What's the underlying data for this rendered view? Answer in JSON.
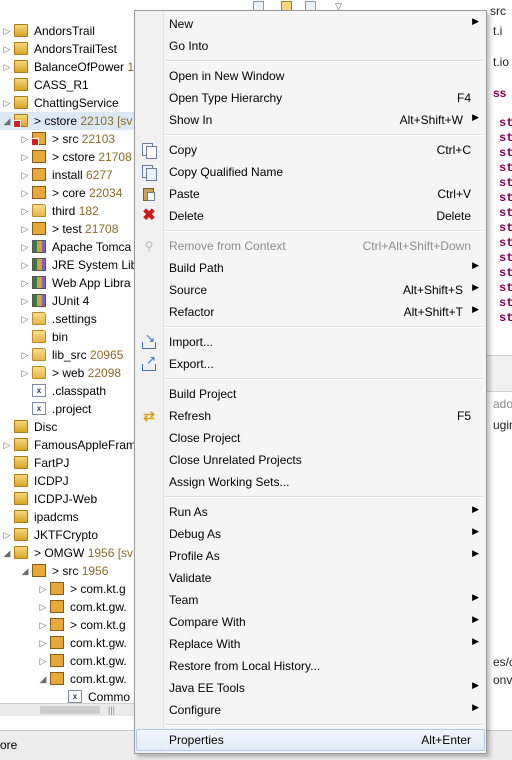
{
  "explorer": {
    "items": [
      {
        "label": "AndorsTrail",
        "count": "",
        "indent": 0,
        "arrow": "▷",
        "icon": "project-icon",
        "kind": "project"
      },
      {
        "label": "AndorsTrailTest",
        "count": "",
        "indent": 0,
        "arrow": "▷",
        "icon": "project-icon",
        "kind": "project"
      },
      {
        "label": "BalanceOfPower",
        "count": "1",
        "indent": 0,
        "arrow": "▷",
        "icon": "project-icon",
        "kind": "project"
      },
      {
        "label": "CASS_R1",
        "count": "",
        "indent": 0,
        "arrow": "",
        "icon": "project-icon",
        "kind": "project"
      },
      {
        "label": "ChattingService",
        "count": "",
        "indent": 0,
        "arrow": "▷",
        "icon": "project-icon",
        "kind": "project"
      },
      {
        "label": "> cstore",
        "count": "22103 [sv",
        "indent": 0,
        "arrow": "◢",
        "icon": "project-icon",
        "kind": "project",
        "error": true,
        "selected": true
      },
      {
        "label": "> src",
        "count": "22103",
        "indent": 1,
        "arrow": "▷",
        "icon": "source-folder-icon",
        "kind": "package",
        "error": true
      },
      {
        "label": "> cstore",
        "count": "21708",
        "indent": 1,
        "arrow": "▷",
        "icon": "source-folder-icon",
        "kind": "package"
      },
      {
        "label": "install",
        "count": "6277",
        "indent": 1,
        "arrow": "▷",
        "icon": "source-folder-icon",
        "kind": "package"
      },
      {
        "label": "> core",
        "count": "22034",
        "indent": 1,
        "arrow": "▷",
        "icon": "source-folder-icon",
        "kind": "package"
      },
      {
        "label": "third",
        "count": "182",
        "indent": 1,
        "arrow": "▷",
        "icon": "folder-icon",
        "kind": "folder"
      },
      {
        "label": "> test",
        "count": "21708",
        "indent": 1,
        "arrow": "▷",
        "icon": "source-folder-icon",
        "kind": "package"
      },
      {
        "label": "Apache Tomca",
        "count": "",
        "indent": 1,
        "arrow": "▷",
        "icon": "library-icon",
        "kind": "lib"
      },
      {
        "label": "JRE System Lib",
        "count": "",
        "indent": 1,
        "arrow": "▷",
        "icon": "library-icon",
        "kind": "lib"
      },
      {
        "label": "Web App Libra",
        "count": "",
        "indent": 1,
        "arrow": "▷",
        "icon": "library-icon",
        "kind": "lib"
      },
      {
        "label": "JUnit 4",
        "count": "",
        "indent": 1,
        "arrow": "▷",
        "icon": "library-icon",
        "kind": "lib"
      },
      {
        "label": ".settings",
        "count": "",
        "indent": 1,
        "arrow": "▷",
        "icon": "folder-icon",
        "kind": "folder"
      },
      {
        "label": "bin",
        "count": "",
        "indent": 1,
        "arrow": "",
        "icon": "folder-icon",
        "kind": "folder"
      },
      {
        "label": "lib_src",
        "count": "20965",
        "indent": 1,
        "arrow": "▷",
        "icon": "folder-icon",
        "kind": "folder"
      },
      {
        "label": "> web",
        "count": "22098",
        "indent": 1,
        "arrow": "▷",
        "icon": "folder-icon",
        "kind": "folder"
      },
      {
        "label": ".classpath",
        "count": "",
        "indent": 1,
        "arrow": "",
        "icon": "file-icon",
        "kind": "file"
      },
      {
        "label": ".project",
        "count": "",
        "indent": 1,
        "arrow": "",
        "icon": "file-icon",
        "kind": "file"
      },
      {
        "label": "Disc",
        "count": "",
        "indent": 0,
        "arrow": "",
        "icon": "project-icon",
        "kind": "project"
      },
      {
        "label": "FamousAppleFram",
        "count": "",
        "indent": 0,
        "arrow": "▷",
        "icon": "project-icon",
        "kind": "project"
      },
      {
        "label": "FartPJ",
        "count": "",
        "indent": 0,
        "arrow": "",
        "icon": "project-icon",
        "kind": "project"
      },
      {
        "label": "ICDPJ",
        "count": "",
        "indent": 0,
        "arrow": "",
        "icon": "project-icon",
        "kind": "project"
      },
      {
        "label": "ICDPJ-Web",
        "count": "",
        "indent": 0,
        "arrow": "",
        "icon": "project-icon",
        "kind": "project"
      },
      {
        "label": "ipadcms",
        "count": "",
        "indent": 0,
        "arrow": "",
        "icon": "project-icon",
        "kind": "project"
      },
      {
        "label": "JKTFCrypto",
        "count": "",
        "indent": 0,
        "arrow": "▷",
        "icon": "project-icon",
        "kind": "project"
      },
      {
        "label": "> OMGW",
        "count": "1956 [sv",
        "indent": 0,
        "arrow": "◢",
        "icon": "project-icon",
        "kind": "project"
      },
      {
        "label": "> src",
        "count": "1956",
        "indent": 1,
        "arrow": "◢",
        "icon": "source-folder-icon",
        "kind": "package"
      },
      {
        "label": "> com.kt.g",
        "count": "",
        "indent": 2,
        "arrow": "▷",
        "icon": "package-icon",
        "kind": "package"
      },
      {
        "label": "com.kt.gw.",
        "count": "",
        "indent": 2,
        "arrow": "▷",
        "icon": "package-icon",
        "kind": "package"
      },
      {
        "label": "> com.kt.g",
        "count": "",
        "indent": 2,
        "arrow": "▷",
        "icon": "package-icon",
        "kind": "package"
      },
      {
        "label": "com.kt.gw.",
        "count": "",
        "indent": 2,
        "arrow": "▷",
        "icon": "package-icon",
        "kind": "package"
      },
      {
        "label": "com.kt.gw.",
        "count": "",
        "indent": 2,
        "arrow": "▷",
        "icon": "package-icon",
        "kind": "package"
      },
      {
        "label": "com.kt.gw.",
        "count": "",
        "indent": 2,
        "arrow": "◢",
        "icon": "package-icon",
        "kind": "package"
      },
      {
        "label": "Commo",
        "count": "",
        "indent": 3,
        "arrow": "",
        "icon": "file-icon",
        "kind": "file"
      }
    ]
  },
  "context_menu": {
    "items": [
      {
        "type": "item",
        "label": "New",
        "shortcut": "",
        "submenu": true
      },
      {
        "type": "item",
        "label": "Go Into",
        "shortcut": ""
      },
      {
        "type": "sep"
      },
      {
        "type": "item",
        "label": "Open in New Window",
        "shortcut": ""
      },
      {
        "type": "item",
        "label": "Open Type Hierarchy",
        "shortcut": "F4"
      },
      {
        "type": "item",
        "label": "Show In",
        "shortcut": "Alt+Shift+W",
        "submenu": true
      },
      {
        "type": "sep"
      },
      {
        "type": "item",
        "label": "Copy",
        "shortcut": "Ctrl+C",
        "icon": "copy-icon",
        "iconClass": "copy"
      },
      {
        "type": "item",
        "label": "Copy Qualified Name",
        "shortcut": "",
        "icon": "copy-qualified-name-icon",
        "iconClass": "copyq"
      },
      {
        "type": "item",
        "label": "Paste",
        "shortcut": "Ctrl+V",
        "icon": "paste-icon",
        "iconClass": "paste"
      },
      {
        "type": "item",
        "label": "Delete",
        "shortcut": "Delete",
        "icon": "delete-icon",
        "iconClass": "delete",
        "glyph": "✖"
      },
      {
        "type": "sep"
      },
      {
        "type": "item",
        "label": "Remove from Context",
        "shortcut": "Ctrl+Alt+Shift+Down",
        "disabled": true,
        "icon": "remove-context-icon",
        "iconClass": "remove",
        "glyph": "⚲"
      },
      {
        "type": "item",
        "label": "Build Path",
        "shortcut": "",
        "submenu": true
      },
      {
        "type": "item",
        "label": "Source",
        "shortcut": "Alt+Shift+S",
        "submenu": true
      },
      {
        "type": "item",
        "label": "Refactor",
        "shortcut": "Alt+Shift+T",
        "submenu": true
      },
      {
        "type": "sep"
      },
      {
        "type": "item",
        "label": "Import...",
        "shortcut": "",
        "icon": "import-icon",
        "iconClass": "import"
      },
      {
        "type": "item",
        "label": "Export...",
        "shortcut": "",
        "icon": "export-icon",
        "iconClass": "export"
      },
      {
        "type": "sep"
      },
      {
        "type": "item",
        "label": "Build Project",
        "shortcut": ""
      },
      {
        "type": "item",
        "label": "Refresh",
        "shortcut": "F5",
        "icon": "refresh-icon",
        "iconClass": "refresh",
        "glyph": "⇄"
      },
      {
        "type": "item",
        "label": "Close Project",
        "shortcut": ""
      },
      {
        "type": "item",
        "label": "Close Unrelated Projects",
        "shortcut": ""
      },
      {
        "type": "item",
        "label": "Assign Working Sets...",
        "shortcut": ""
      },
      {
        "type": "sep"
      },
      {
        "type": "item",
        "label": "Run As",
        "shortcut": "",
        "submenu": true
      },
      {
        "type": "item",
        "label": "Debug As",
        "shortcut": "",
        "submenu": true
      },
      {
        "type": "item",
        "label": "Profile As",
        "shortcut": "",
        "submenu": true
      },
      {
        "type": "item",
        "label": "Validate",
        "shortcut": ""
      },
      {
        "type": "item",
        "label": "Team",
        "shortcut": "",
        "submenu": true
      },
      {
        "type": "item",
        "label": "Compare With",
        "shortcut": "",
        "submenu": true
      },
      {
        "type": "item",
        "label": "Replace With",
        "shortcut": "",
        "submenu": true
      },
      {
        "type": "item",
        "label": "Restore from Local History...",
        "shortcut": ""
      },
      {
        "type": "item",
        "label": "Java EE Tools",
        "shortcut": "",
        "submenu": true
      },
      {
        "type": "item",
        "label": "Configure",
        "shortcut": "",
        "submenu": true
      },
      {
        "type": "sep"
      },
      {
        "type": "item",
        "label": "Properties",
        "shortcut": "Alt+Enter",
        "highlight": true
      }
    ]
  },
  "editor": {
    "tab_label": "src",
    "line_fragments": [
      "t.i",
      "t.io",
      "ss"
    ],
    "keyword": "st",
    "lower_fragments": [
      "ado",
      "ugin,",
      "es/c",
      "onve"
    ]
  },
  "statusbar": {
    "text": "ore"
  }
}
